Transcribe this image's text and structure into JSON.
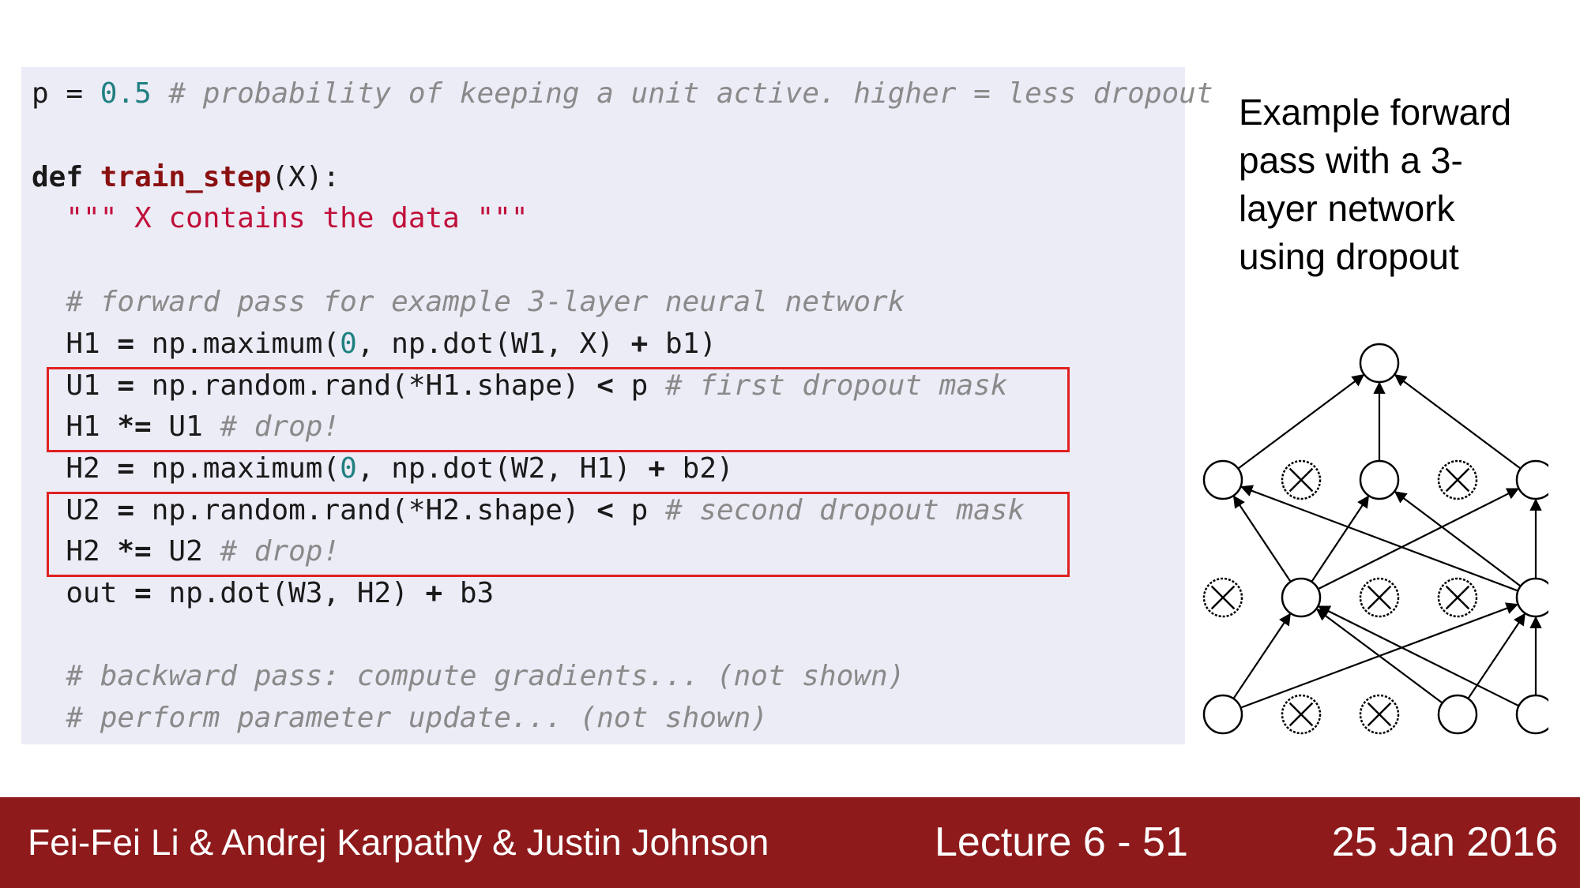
{
  "code": {
    "l1": {
      "var": "p = ",
      "num": "0.5",
      "comment": " # probability of keeping a unit active. higher = less dropout"
    },
    "l2": {
      "kw": "def",
      "sp": " ",
      "fn": "train_step",
      "rest": "(X):"
    },
    "l3": {
      "doc": "  \"\"\" X contains the data \"\"\""
    },
    "l4": {
      "comment": "  # forward pass for example 3-layer neural network"
    },
    "l5": {
      "a": "  H1 ",
      "op": "=",
      "b": " np.maximum(",
      "num": "0",
      "c": ", np.dot(W1, X) ",
      "op2": "+",
      "d": " b1)"
    },
    "l6": {
      "a": "  U1 ",
      "op": "=",
      "b": " np.random.rand(*H1.shape) ",
      "op2": "<",
      "c": " p",
      "comment": " # first dropout mask"
    },
    "l7": {
      "a": "  H1 ",
      "op": "*=",
      "b": " U1",
      "comment": " # drop!"
    },
    "l8": {
      "a": "  H2 ",
      "op": "=",
      "b": " np.maximum(",
      "num": "0",
      "c": ", np.dot(W2, H1) ",
      "op2": "+",
      "d": " b2)"
    },
    "l9": {
      "a": "  U2 ",
      "op": "=",
      "b": " np.random.rand(*H2.shape) ",
      "op2": "<",
      "c": " p",
      "comment": " # second dropout mask"
    },
    "l10": {
      "a": "  H2 ",
      "op": "*=",
      "b": " U2",
      "comment": " # drop!"
    },
    "l11": {
      "a": "  out ",
      "op": "=",
      "b": " np.dot(W3, H2) ",
      "op2": "+",
      "c": " b3"
    },
    "l12": {
      "comment": "  # backward pass: compute gradients... (not shown)"
    },
    "l13": {
      "comment": "  # perform parameter update... (not shown)"
    }
  },
  "side_caption": {
    "line1": "Example forward",
    "line2": "pass with a 3-",
    "line3": "layer network",
    "line4": "using dropout"
  },
  "diagram": {
    "layers": [
      [
        "active",
        "active",
        "active"
      ],
      [
        "active"
      ]
    ],
    "input_units": [
      "active",
      "dropped",
      "dropped",
      "active",
      "active"
    ],
    "hidden1_units": [
      "dropped",
      "active",
      "dropped",
      "dropped",
      "active"
    ],
    "hidden2_units": [
      "active",
      "dropped",
      "active",
      "dropped",
      "active"
    ],
    "output_units": [
      "active"
    ]
  },
  "footer": {
    "authors": "Fei-Fei Li & Andrej Karpathy & Justin Johnson",
    "lecture": "Lecture 6 - 51",
    "date": "25 Jan 2016"
  },
  "colors": {
    "footer_bg": "#8e1a1c",
    "highlight_box": "#e02020",
    "code_bg": "#ececf7"
  }
}
